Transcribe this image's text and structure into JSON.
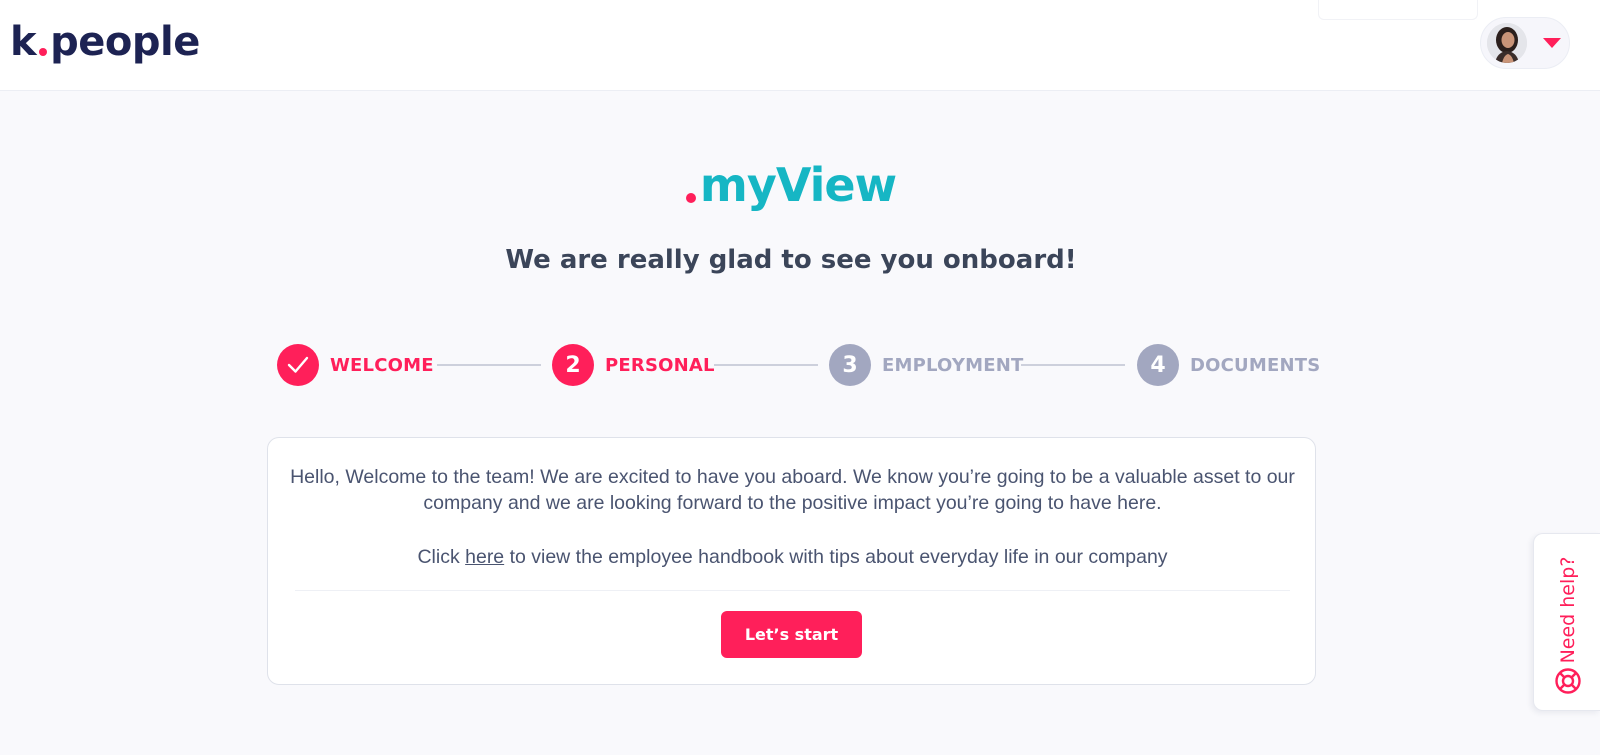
{
  "header": {
    "logo": {
      "left": "k",
      "right": "people",
      "dot_color": "#ff1f5a",
      "text_color": "#1d2353"
    },
    "user_menu": {
      "avatar_icon": "user-avatar",
      "caret_icon": "caret-down-icon"
    }
  },
  "brand": {
    "name": "myView",
    "color": "#16b6c4",
    "dot_color": "#ff1f5a"
  },
  "heading": "We are really glad to see you onboard!",
  "stepper": {
    "steps": [
      {
        "number": "",
        "label": "WELCOME",
        "state": "completed",
        "icon": "check-icon"
      },
      {
        "number": "2",
        "label": "PERSONAL",
        "state": "current"
      },
      {
        "number": "3",
        "label": "EMPLOYMENT",
        "state": "upcoming"
      },
      {
        "number": "4",
        "label": "DOCUMENTS",
        "state": "upcoming"
      }
    ],
    "active_color": "#ff1f5a",
    "inactive_color": "#a2a7c0"
  },
  "card": {
    "intro": "Hello, Welcome to the team! We are excited to have you aboard. We know you’re going to be a valuable asset to our company and we are looking forward to the positive impact you’re going to have here.",
    "link_prefix": "Click",
    "link_text": "here",
    "link_suffix": "to view the employee handbook with tips about everyday life in our company",
    "button_label": "Let’s start"
  },
  "help": {
    "label": "Need help?",
    "icon": "lifebuoy-icon"
  },
  "colors": {
    "accent": "#ff1f5a",
    "teal": "#16b6c4",
    "navy": "#1d2353",
    "background": "#f9f9fc"
  }
}
